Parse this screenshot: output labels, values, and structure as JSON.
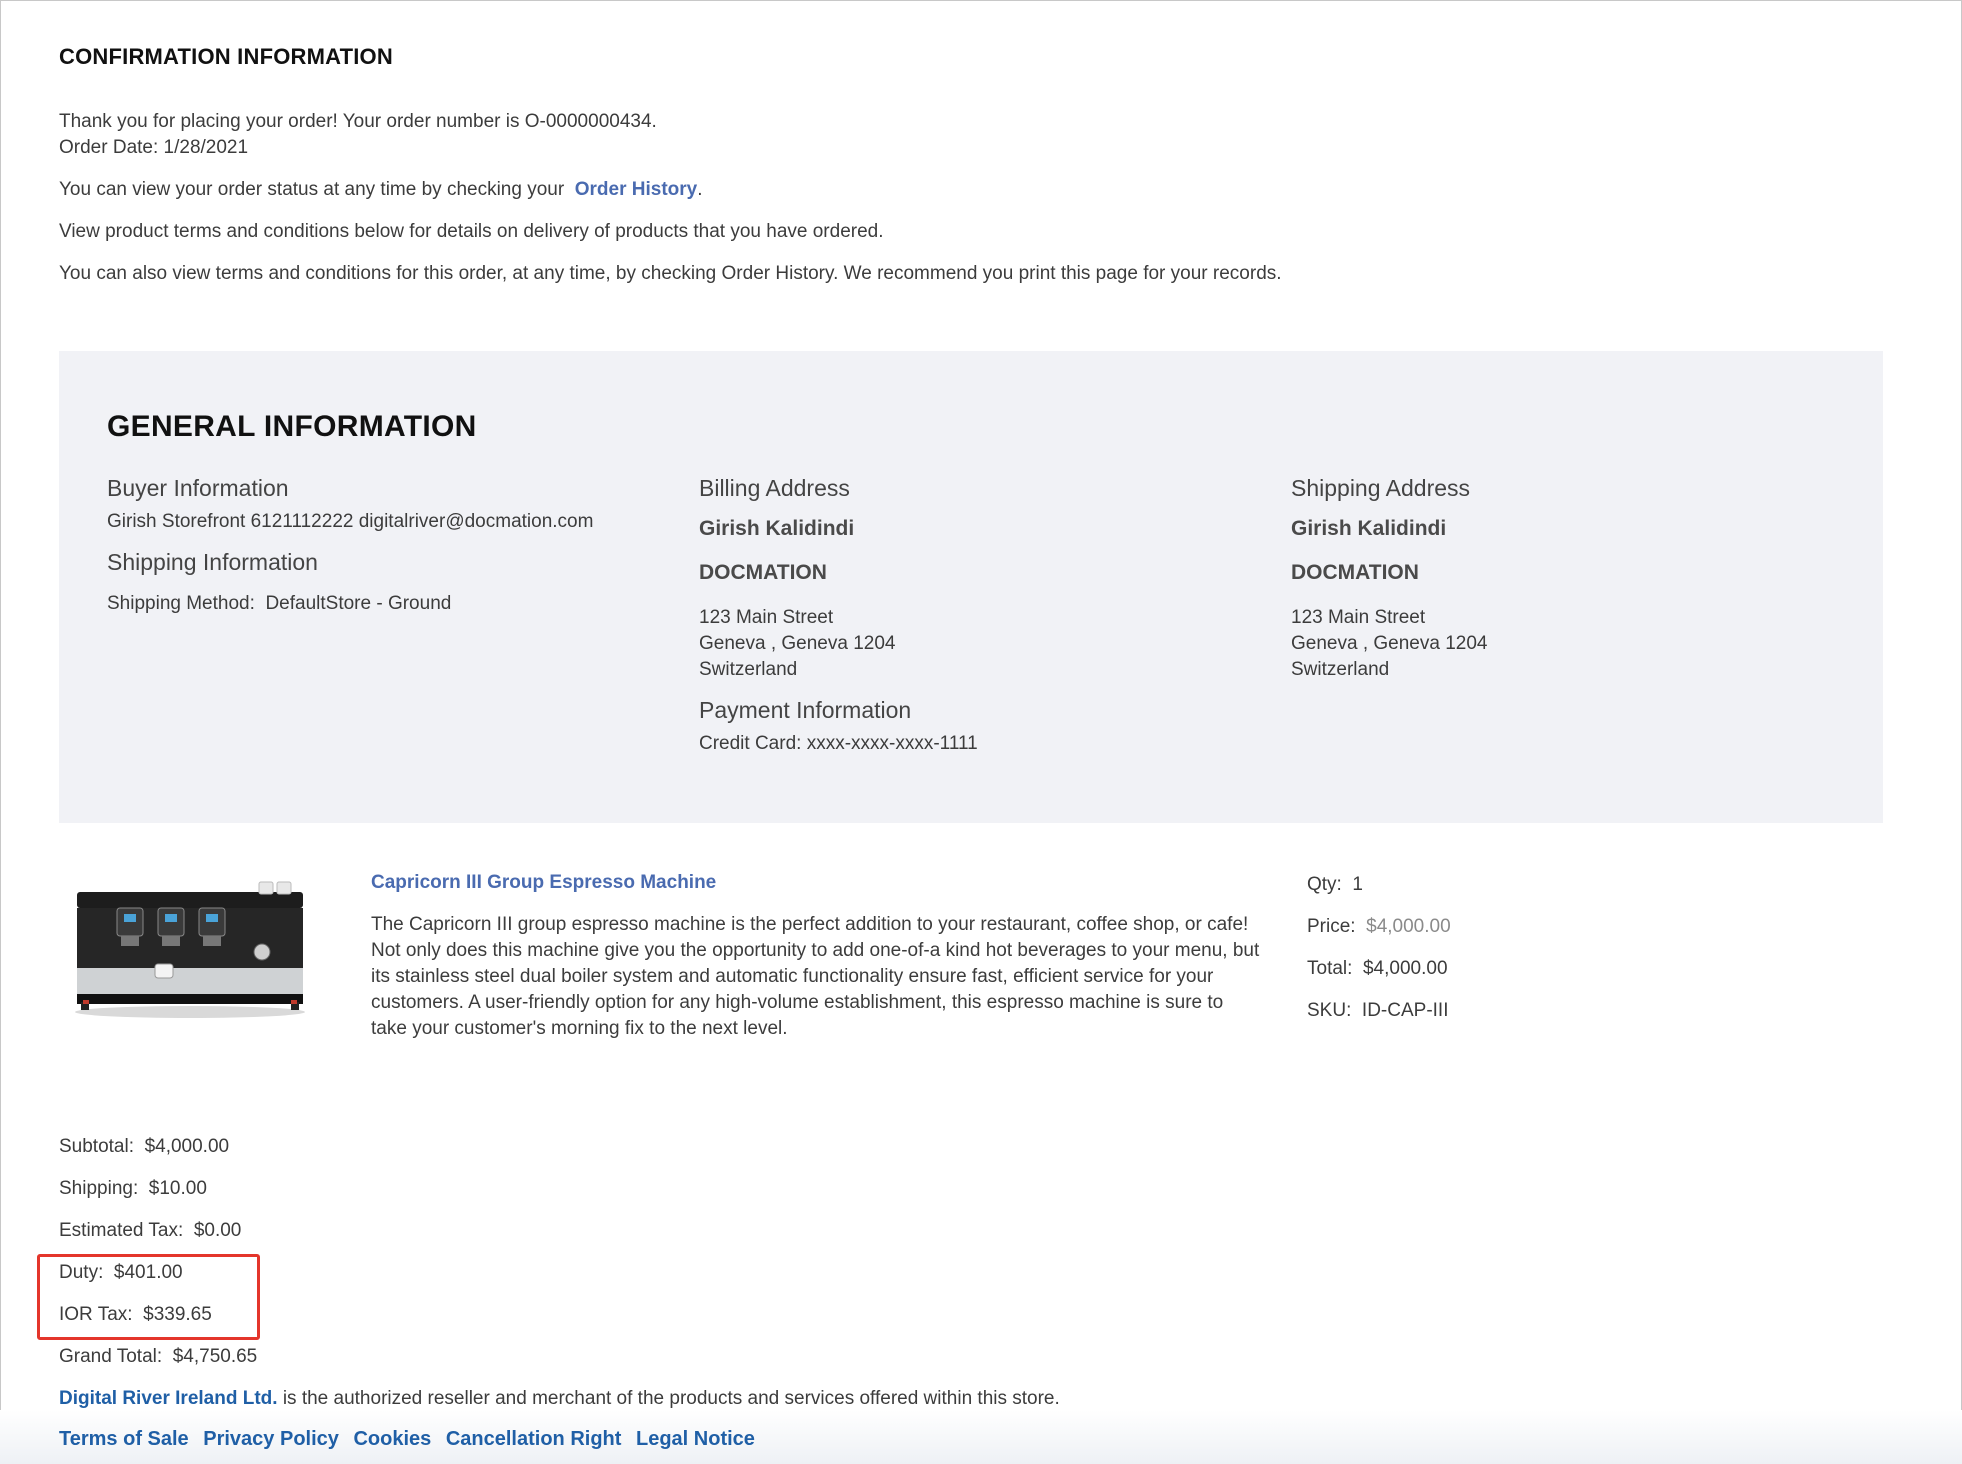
{
  "confirmation": {
    "title": "CONFIRMATION INFORMATION",
    "thank_you": "Thank you for placing your order! Your order number is O-0000000434.",
    "order_date": "Order Date: 1/28/2021",
    "status_prefix": "You can view your order status at any time by checking your",
    "order_history_link": "Order History",
    "status_suffix": ".",
    "terms_line": "View product terms and conditions below for details on delivery of products that you have ordered.",
    "print_line": "You can also view terms and conditions for this order, at any time, by checking Order History. We recommend you print this page for your records."
  },
  "general": {
    "title": "GENERAL INFORMATION",
    "buyer_heading": "Buyer Information",
    "buyer_details": "Girish Storefront 6121112222 digitalriver@docmation.com",
    "shipping_info_heading": "Shipping Information",
    "shipping_method_label": "Shipping Method:",
    "shipping_method_value": "DefaultStore - Ground",
    "billing": {
      "heading": "Billing Address",
      "name": "Girish  Kalidindi",
      "company": "DOCMATION",
      "street": "123 Main Street",
      "city_line": "Geneva , Geneva  1204",
      "country": "Switzerland"
    },
    "shipping": {
      "heading": "Shipping Address",
      "name": "Girish  Kalidindi",
      "company": "DOCMATION",
      "street": "123 Main Street",
      "city_line": "Geneva , Geneva  1204",
      "country": "Switzerland"
    },
    "payment_heading": "Payment Information",
    "payment_details": "Credit Card: xxxx-xxxx-xxxx-1111"
  },
  "product": {
    "image_icon": "espresso-machine-image",
    "name": "Capricorn III Group Espresso Machine",
    "description": "The Capricorn III group espresso machine is the perfect addition to your restaurant, coffee shop, or cafe! Not only does this machine give you the opportunity to add one-of-a kind hot beverages to your menu, but its stainless steel dual boiler system and automatic functionality ensure fast, efficient service for your customers. A user-friendly option for any high-volume establishment, this espresso machine is sure to take your customer's morning fix to the next level.",
    "qty_label": "Qty:",
    "qty_value": "1",
    "price_label": "Price:",
    "price_value": "$4,000.00",
    "total_label": "Total:",
    "total_value": "$4,000.00",
    "sku_label": "SKU:",
    "sku_value": "ID-CAP-III"
  },
  "totals": {
    "subtotal_label": "Subtotal:",
    "subtotal_value": "$4,000.00",
    "shipping_label": "Shipping:",
    "shipping_value": "$10.00",
    "tax_label": "Estimated Tax:",
    "tax_value": "$0.00",
    "duty_label": "Duty:",
    "duty_value": "$401.00",
    "ior_label": "IOR Tax:",
    "ior_value": "$339.65",
    "grand_label": "Grand Total:",
    "grand_value": "$4,750.65"
  },
  "footer": {
    "merchant_link": "Digital River Ireland Ltd.",
    "merchant_text": "is the authorized reseller and merchant of the products and services offered within this store.",
    "links": [
      "Terms of Sale",
      "Privacy Policy",
      "Cookies",
      "Cancellation Right",
      "Legal Notice"
    ]
  },
  "colors": {
    "link": "#4a6bb0",
    "footer_link": "#1f5fa6",
    "panel_bg": "#f1f2f6",
    "highlight_border": "#e4352b"
  }
}
